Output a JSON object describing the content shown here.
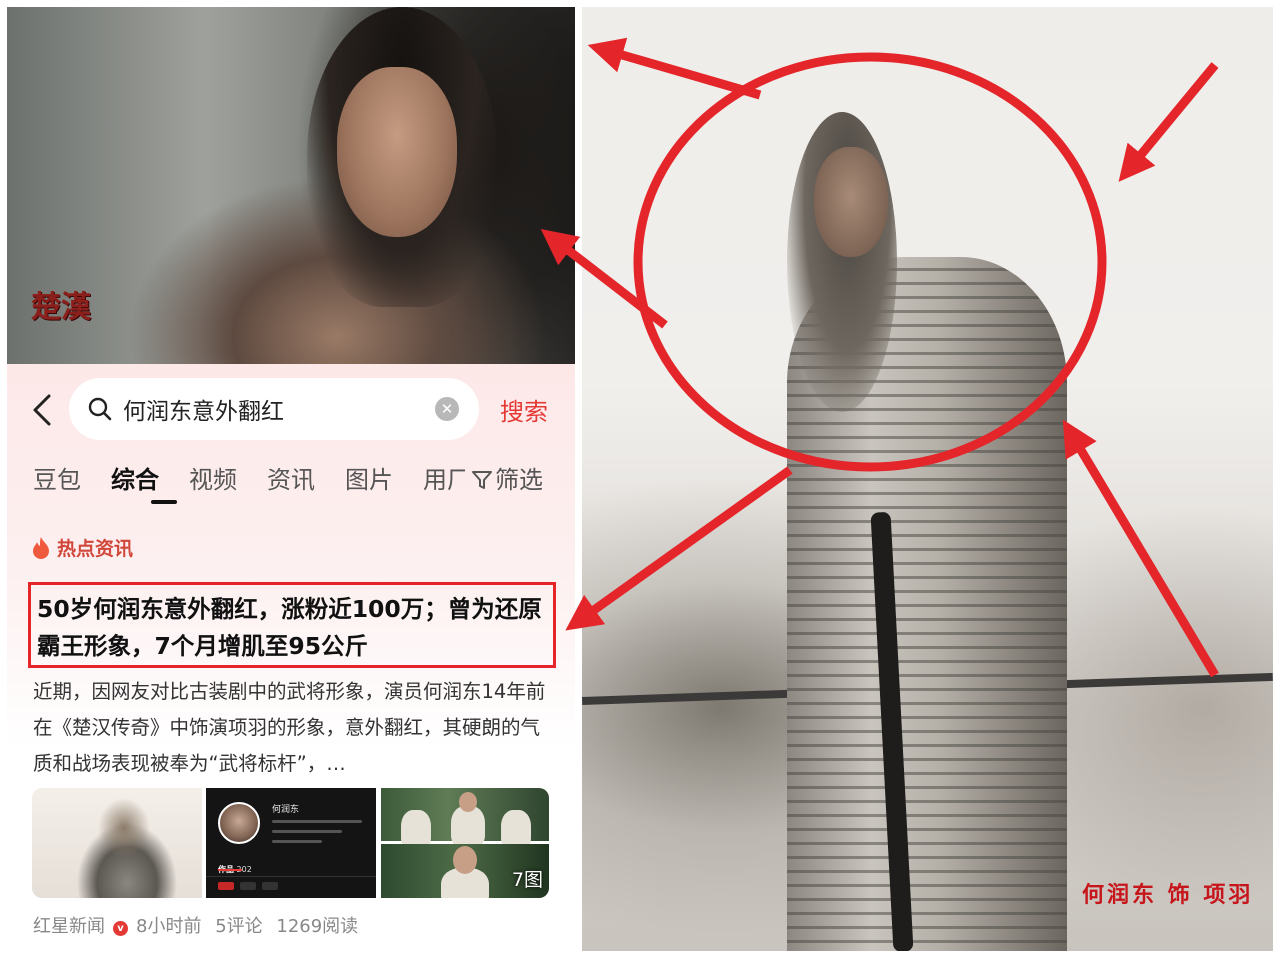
{
  "top_image": {
    "drama_logo": "楚漢"
  },
  "search": {
    "query": "何润东意外翻红",
    "search_label": "搜索",
    "clear_label": "✕"
  },
  "tabs": [
    {
      "label": "豆包"
    },
    {
      "label": "综合",
      "active": true
    },
    {
      "label": "视频"
    },
    {
      "label": "资讯"
    },
    {
      "label": "图片"
    },
    {
      "label": "用厂"
    }
  ],
  "filter_label": "筛选",
  "section_label": "热点资讯",
  "article": {
    "headline": "50岁何润东意外翻红，涨粉近100万；曾为还原霸王形象，7个月增肌至95公斤",
    "summary": "近期，因网友对比古装剧中的武将形象，演员何润东14年前在《楚汉传奇》中饰演项羽的形象，意外翻红，其硬朗的气质和战场表现被奉为“武将标杆”，…",
    "profile_card": {
      "name": "何润东",
      "works_label": "作品",
      "works_count": "202"
    },
    "image_count": "7图",
    "source": "红星新闻",
    "verified_badge": "v",
    "time": "8小时前",
    "comments": "5评论",
    "reads": "1269阅读"
  },
  "right_image": {
    "caption": "何润东 饰 项羽"
  },
  "colors": {
    "accent_red": "#e53935",
    "annotation_red": "#e4262b"
  }
}
